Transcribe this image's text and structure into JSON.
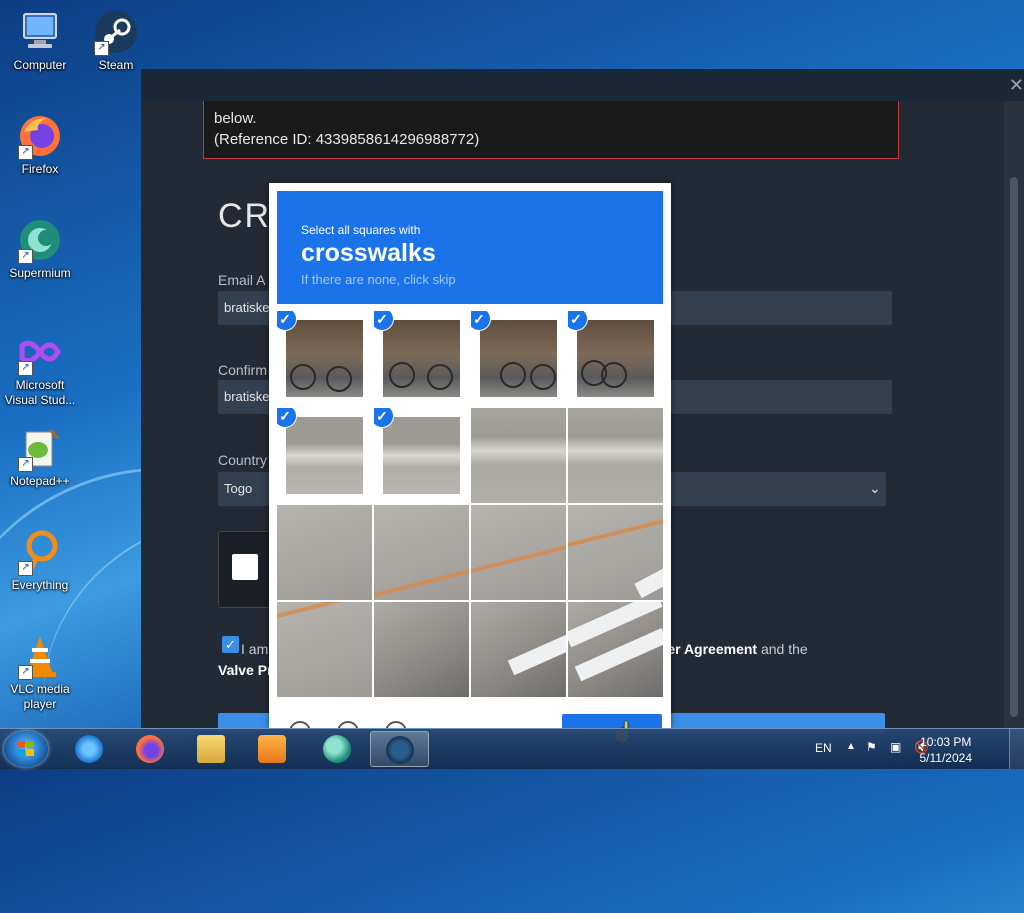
{
  "desktop": {
    "icons": [
      {
        "label": "Computer"
      },
      {
        "label": "Steam"
      },
      {
        "label": "Firefox"
      },
      {
        "label": "Supermium"
      },
      {
        "label": "Microsoft Visual Stud..."
      },
      {
        "label": "Notepad++"
      },
      {
        "label": "Everything"
      },
      {
        "label": "VLC media player"
      }
    ]
  },
  "page": {
    "error_line1": "below.",
    "error_line2": "(Reference ID: 4339858614296988772)",
    "title": "CRI",
    "email_label": "Email A",
    "email_value": "bratiske",
    "confirm_label": "Confirm",
    "confirm_value": "bratiske",
    "country_label": "Country",
    "country_value": "Togo",
    "agree_prefix": "I am",
    "agree_link": "o Subscriber Agreement",
    "agree_suffix": " and the",
    "agree_line2": "Valve Pr"
  },
  "captcha": {
    "instruction": "Select all squares with",
    "target": "crosswalks",
    "hint": "If there are none, click skip",
    "tiles_selected": [
      true,
      true,
      true,
      true,
      true,
      true,
      false,
      false,
      false,
      false,
      false,
      false,
      false,
      false,
      false,
      false
    ],
    "verify_label": ""
  },
  "taskbar": {
    "language": "EN",
    "time": "10:03 PM",
    "date": "5/11/2024"
  },
  "colors": {
    "captcha_blue": "#1a73e8",
    "steam_bg": "#212a35",
    "error_border": "#c03b3b"
  }
}
